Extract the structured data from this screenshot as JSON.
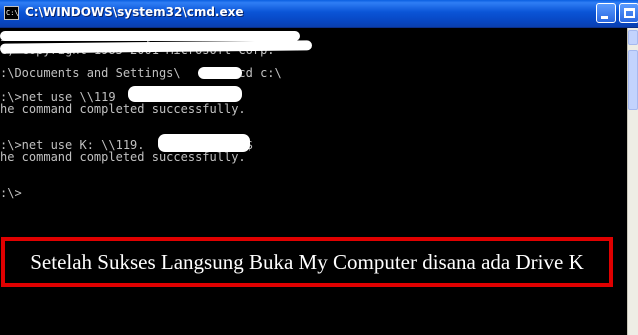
{
  "window": {
    "title": "C:\\WINDOWS\\system32\\cmd.exe",
    "icon_text": "C:\\",
    "icon": "console-app-icon",
    "controls": {
      "minimize": "minimize-icon",
      "maximize": "maximize-icon"
    }
  },
  "console": {
    "lines": [
      "icrosoft Windows XP [Version 5.1.2600]",
      "C) Copyright 1985-2001 Microsoft Corp.",
      ":\\Documents and Settings\\       >cd c:\\",
      ":\\>net use \\\\119",
      "he command completed successfully.",
      ":\\>net use K: \\\\119.            \\c$",
      "he command completed successfully.",
      ":\\>"
    ]
  },
  "caption": {
    "text": "Setelah Sukses Langsung Buka My Computer disana ada Drive K",
    "border_color": "#e00000"
  },
  "colors": {
    "titlebar": "#0a54d6",
    "console_bg": "#000000",
    "console_text": "#c0c0c0"
  }
}
